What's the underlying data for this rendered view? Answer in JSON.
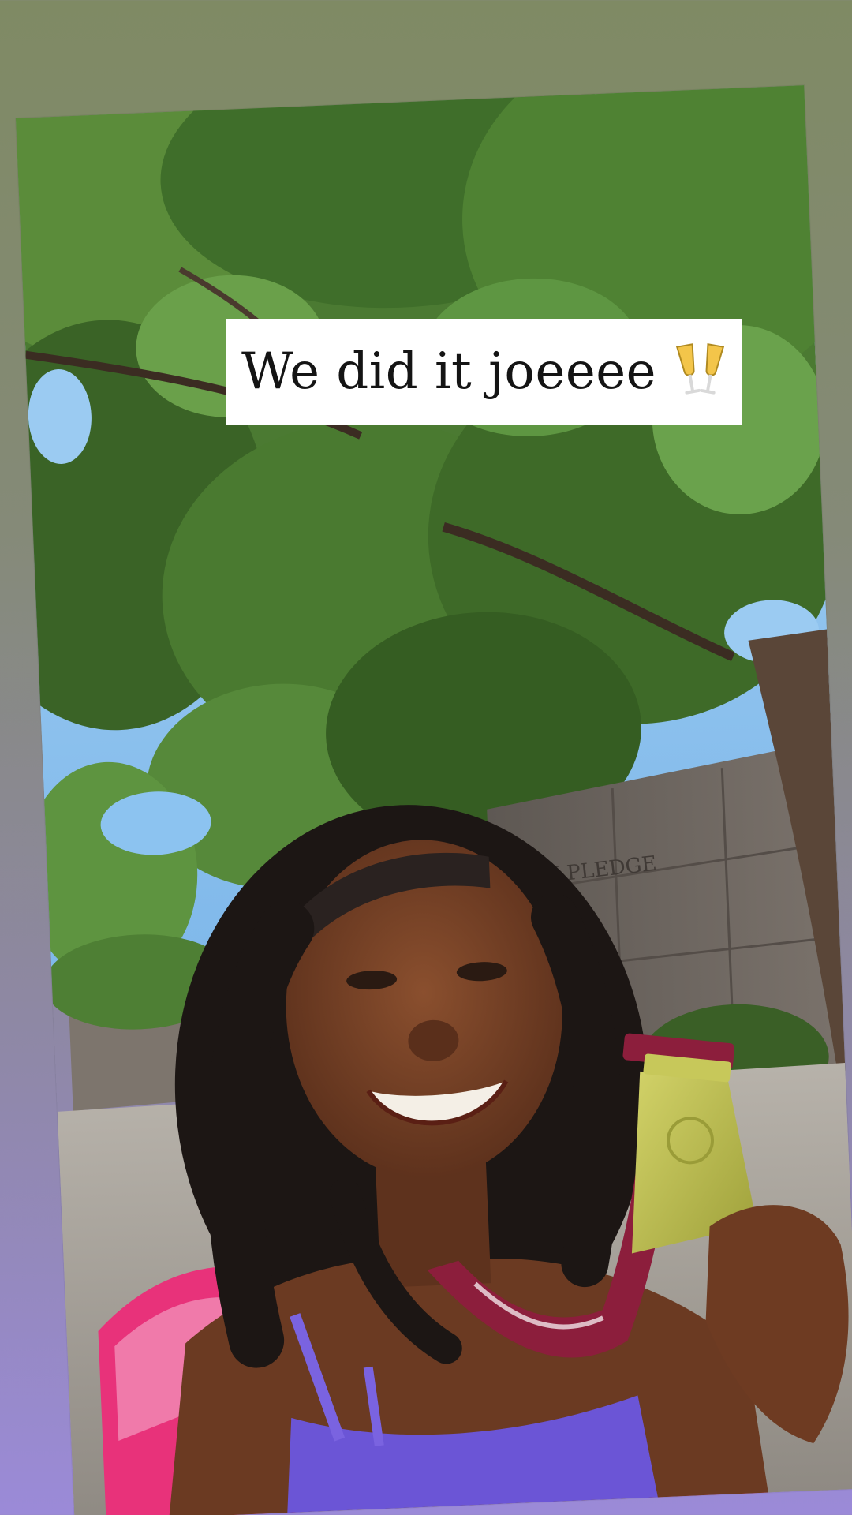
{
  "caption": {
    "text": "We did it joeeee",
    "emoji": "champagne-glasses-emoji"
  },
  "background": {
    "top_color": "#7f8a64",
    "bottom_color": "#9b8ad8"
  },
  "photo": {
    "subject": "selfie-with-medal",
    "engraving": "I PLEDGE"
  },
  "colors": {
    "sky": "#8cc3f0",
    "foliage": "#3f6a2a",
    "wall": "#6e6660",
    "path": "#a8a39c",
    "skin": "#6b3a22",
    "hair": "#1c1614",
    "medal": "#b7b84e",
    "ribbon": "#8c1e3c",
    "towel": "#e8327a",
    "top": "#6b55d6"
  }
}
